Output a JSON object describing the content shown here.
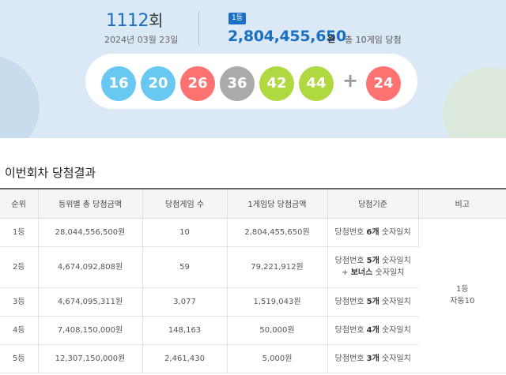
{
  "draw": {
    "round_number": "1112",
    "round_suffix": "회",
    "date": "2024년 03월 23일",
    "rank_badge": "1등",
    "first_prize_amount": "2,804,455,650",
    "first_prize_unit": "원",
    "first_prize_winners": "총 10게임 당첨"
  },
  "numbers": {
    "main": [
      {
        "value": "16",
        "color": "#69c8f2"
      },
      {
        "value": "20",
        "color": "#69c8f2"
      },
      {
        "value": "26",
        "color": "#ff7272"
      },
      {
        "value": "36",
        "color": "#aaaaaa"
      },
      {
        "value": "42",
        "color": "#b0d840"
      },
      {
        "value": "44",
        "color": "#b0d840"
      }
    ],
    "plus_sign": "+",
    "bonus": {
      "value": "24",
      "color": "#ff7272"
    }
  },
  "section_title": "이번회차 당첨결과",
  "table": {
    "headers": [
      "순위",
      "등위별 총 당첨금액",
      "당첨게임 수",
      "1게임당 당첨금액",
      "당첨기준",
      "비고"
    ],
    "rows": [
      {
        "rank": "1등",
        "total": "28,044,556,500원",
        "games": "10",
        "per_game": "2,804,455,650원",
        "criteria_pre": "당첨번호 ",
        "criteria_bold": "6개",
        "criteria_post": " 숫자일치",
        "criteria_line2": ""
      },
      {
        "rank": "2등",
        "total": "4,674,092,808원",
        "games": "59",
        "per_game": "79,221,912원",
        "criteria_pre": "당첨번호 ",
        "criteria_bold": "5개",
        "criteria_post": " 숫자일치",
        "criteria_line2_pre": "+ ",
        "criteria_line2_bold": "보너스",
        "criteria_line2_post": " 숫자일치"
      },
      {
        "rank": "3등",
        "total": "4,674,095,311원",
        "games": "3,077",
        "per_game": "1,519,043원",
        "criteria_pre": "당첨번호 ",
        "criteria_bold": "5개",
        "criteria_post": " 숫자일치",
        "criteria_line2": ""
      },
      {
        "rank": "4등",
        "total": "7,408,150,000원",
        "games": "148,163",
        "per_game": "50,000원",
        "criteria_pre": "당첨번호 ",
        "criteria_bold": "4개",
        "criteria_post": " 숫자일치",
        "criteria_line2": ""
      },
      {
        "rank": "5등",
        "total": "12,307,150,000원",
        "games": "2,461,430",
        "per_game": "5,000원",
        "criteria_pre": "당첨번호 ",
        "criteria_bold": "3개",
        "criteria_post": " 숫자일치",
        "criteria_line2": ""
      }
    ],
    "note_line1": "1등",
    "note_line2": "자동10"
  }
}
